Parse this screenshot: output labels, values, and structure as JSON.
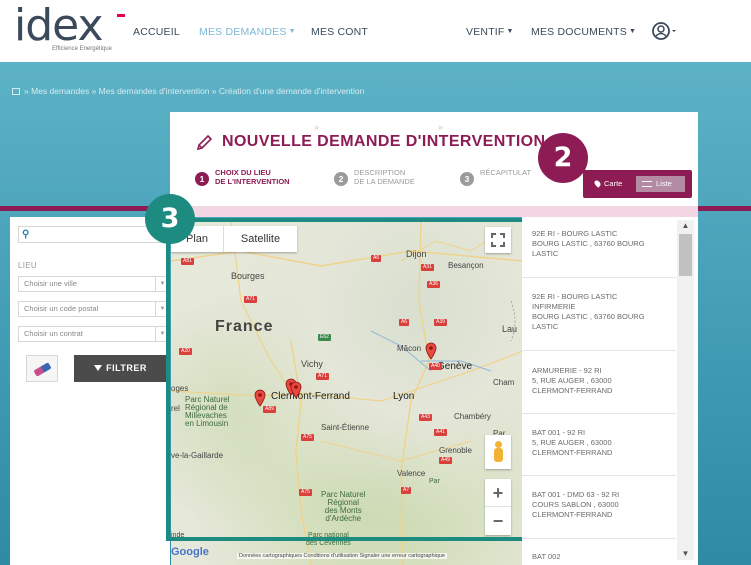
{
  "brand": {
    "logo_text": "idex",
    "tagline": "Efficience Energétique",
    "accent_color": "#8d1c55",
    "annotation_color": "#1d8b7f"
  },
  "nav": {
    "items": [
      {
        "label": "ACCUEIL",
        "caret": ""
      },
      {
        "label": "MES DEMANDES",
        "caret": "▼"
      },
      {
        "label": "MES CONT",
        "caret": ""
      },
      {
        "label": "VENTIF",
        "caret": "▼"
      },
      {
        "label": "MES DOCUMENTS",
        "caret": "▼"
      }
    ],
    "user_caret": "▼"
  },
  "breadcrumb": "» Mes demandes » Mes demandes d'intervention » Création d'une demande d'intervention",
  "page": {
    "title": "NOUVELLE DEMANDE D'INTERVENTION",
    "steps": [
      {
        "num": "1",
        "line1": "CHOIX DU LIEU",
        "line2": "DE L'INTERVENTION"
      },
      {
        "num": "2",
        "line1": "DESCRIPTION",
        "line2": "DE LA DEMANDE"
      },
      {
        "num": "3",
        "line1": "RÉCAPITULAT",
        "line2": ""
      }
    ],
    "step_arrow": "»"
  },
  "badges": {
    "two": "2",
    "three": "3"
  },
  "view_toggle": {
    "map": "Carte",
    "list": "Liste"
  },
  "filters": {
    "search_icon": "search-icon",
    "lieu_label": "LIEU",
    "city_placeholder": "Choisir une ville",
    "postal_placeholder": "Choisir un code postal",
    "contract_placeholder": "Choisir un contrat",
    "filter_button": "FILTRER"
  },
  "map": {
    "tab_plan": "Plan",
    "tab_satellite": "Satellite",
    "zoom_in": "+",
    "zoom_out": "−",
    "google": "Google",
    "footer": "Données cartographiques   Conditions d'utilisation   Signaler une erreur cartographique",
    "labels": {
      "france": "France",
      "dijon": "Dijon",
      "besancon": "Besançon",
      "bourges": "Bourges",
      "vichy": "Vichy",
      "macon": "Mâcon",
      "geneve": "Genève",
      "lyon": "Lyon",
      "clermont": "Clermont-Ferrand",
      "chambery": "Chambéry",
      "saint_etienne": "Saint-Étienne",
      "grenoble": "Grenoble",
      "valence": "Valence",
      "parc_millevaches": "Parc Naturel\nRégional de\nMillevaches\nen Limousin",
      "parc_ardeche": "Parc Naturel\nRégional\ndes Monts\nd'Ardèche",
      "parc_cevennes": "Parc national\ndes Cévennes",
      "paris_fragment": "Lau",
      "cham_fragment": "Cham",
      "par_fragment": "Par",
      "pocs_fragment": "oges",
      "rel_fragment": "rel",
      "ive_fragment": "ve-la-Gaillarde",
      "inde_fragment": "inde"
    }
  },
  "results": [
    {
      "lines": [
        "92E RI - BOURG LASTIC",
        "BOURG LASTIC , 63760 BOURG",
        "LASTIC"
      ]
    },
    {
      "lines": [
        "92E RI - BOURG LASTIC",
        "INFIRMERIE",
        "BOURG LASTIC , 63760 BOURG",
        "LASTIC"
      ]
    },
    {
      "lines": [
        "ARMURERIE - 92 RI",
        "5, RUE AUGER , 63000",
        "CLERMONT-FERRAND"
      ]
    },
    {
      "lines": [
        "BAT 001 - 92 RI",
        "5, RUE AUGER , 63000",
        "CLERMONT-FERRAND"
      ]
    },
    {
      "lines": [
        "BAT 001 - DMD 63 - 92 RI",
        "COURS SABLON , 63000",
        "CLERMONT-FERRAND"
      ]
    },
    {
      "lines": [
        "BAT 002"
      ]
    }
  ],
  "scroll": {
    "up": "▲",
    "down": "▼"
  }
}
